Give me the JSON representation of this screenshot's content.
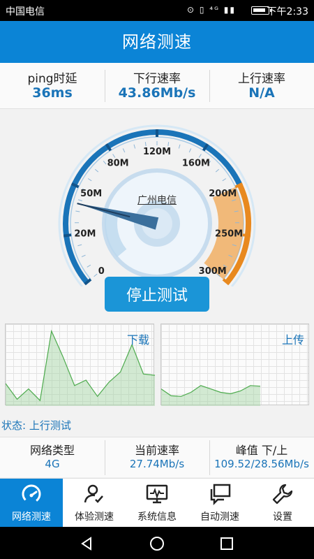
{
  "status_bar": {
    "carrier": "中国电信",
    "indicators": "⊙ ▯ ⁴ᴳ ▮▮ ",
    "time": "下午2:33",
    "battery_level": 0.7
  },
  "header": {
    "title": "网络测速"
  },
  "metrics": [
    {
      "label": "ping时延",
      "value": "36ms"
    },
    {
      "label": "下行速率",
      "value": "43.86Mb/s"
    },
    {
      "label": "上行速率",
      "value": "N/A"
    }
  ],
  "gauge": {
    "isp": "广州电信",
    "ticks": [
      {
        "value": 0,
        "label": "0"
      },
      {
        "value": 20,
        "label": "20M"
      },
      {
        "value": 50,
        "label": "50M"
      },
      {
        "value": 80,
        "label": "80M"
      },
      {
        "value": 120,
        "label": "120M"
      },
      {
        "value": 160,
        "label": "160M"
      },
      {
        "value": 200,
        "label": "200M"
      },
      {
        "value": 250,
        "label": "250M"
      },
      {
        "value": 300,
        "label": "300M"
      }
    ],
    "needle_value": 40,
    "colors": {
      "blue": "#1a74b8",
      "orange": "#e8891f"
    }
  },
  "stop_button": {
    "label": "停止测试"
  },
  "download_chart": {
    "tag": "下载",
    "values": [
      33,
      10,
      25,
      8,
      110,
      72,
      30,
      38,
      14,
      35,
      50,
      90,
      47,
      45
    ]
  },
  "upload_chart": {
    "tag": "上传",
    "values": [
      25,
      15,
      14,
      20,
      30,
      25,
      20,
      18,
      22,
      30,
      29
    ]
  },
  "status": {
    "text": "状态: 上行测试"
  },
  "info": [
    {
      "label": "网络类型",
      "value": "4G"
    },
    {
      "label": "当前速率",
      "value": "27.74Mb/s"
    },
    {
      "label": "峰值  下/上",
      "value": "109.52/28.56Mb/s"
    }
  ],
  "tabs": [
    {
      "label": "网络测速",
      "icon": "speedometer-icon",
      "active": true
    },
    {
      "label": "体验测速",
      "icon": "user-check-icon",
      "active": false
    },
    {
      "label": "系统信息",
      "icon": "monitor-icon",
      "active": false
    },
    {
      "label": "自动测速",
      "icon": "chat-bubbles-icon",
      "active": false
    },
    {
      "label": "设置",
      "icon": "wrench-icon",
      "active": false
    }
  ],
  "navbar": [
    "back-icon",
    "home-icon",
    "recents-icon"
  ]
}
